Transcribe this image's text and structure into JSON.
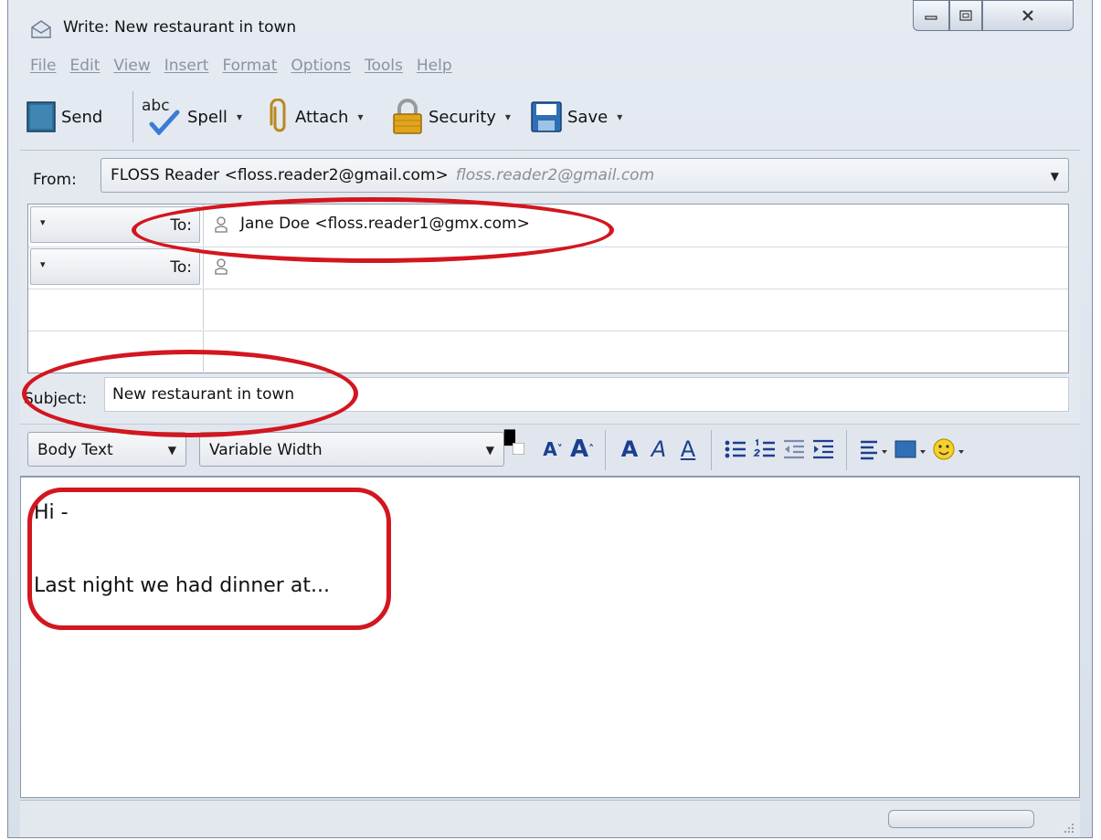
{
  "window": {
    "title": "Write: New restaurant in town"
  },
  "menu": [
    "File",
    "Edit",
    "View",
    "Insert",
    "Format",
    "Options",
    "Tools",
    "Help"
  ],
  "toolbar": {
    "send_label": "Send",
    "spell_label": "Spell",
    "spell_icon_text": "abc",
    "attach_label": "Attach",
    "security_label": "Security",
    "save_label": "Save"
  },
  "header": {
    "from_label": "From:",
    "from_value": "FLOSS Reader <floss.reader2@gmail.com>",
    "from_identity": "floss.reader2@gmail.com",
    "recipients": [
      {
        "type": "To:",
        "address": "Jane Doe <floss.reader1@gmx.com>"
      },
      {
        "type": "To:",
        "address": ""
      }
    ],
    "subject_label": "Subject:",
    "subject_value": "New restaurant in town"
  },
  "format": {
    "paragraph_style": "Body Text",
    "font": "Variable Width"
  },
  "body": {
    "line1": "Hi -",
    "line2": "Last night we had dinner at..."
  },
  "colors": {
    "annotation": "#d3161f",
    "accent": "#1b3f8f"
  }
}
